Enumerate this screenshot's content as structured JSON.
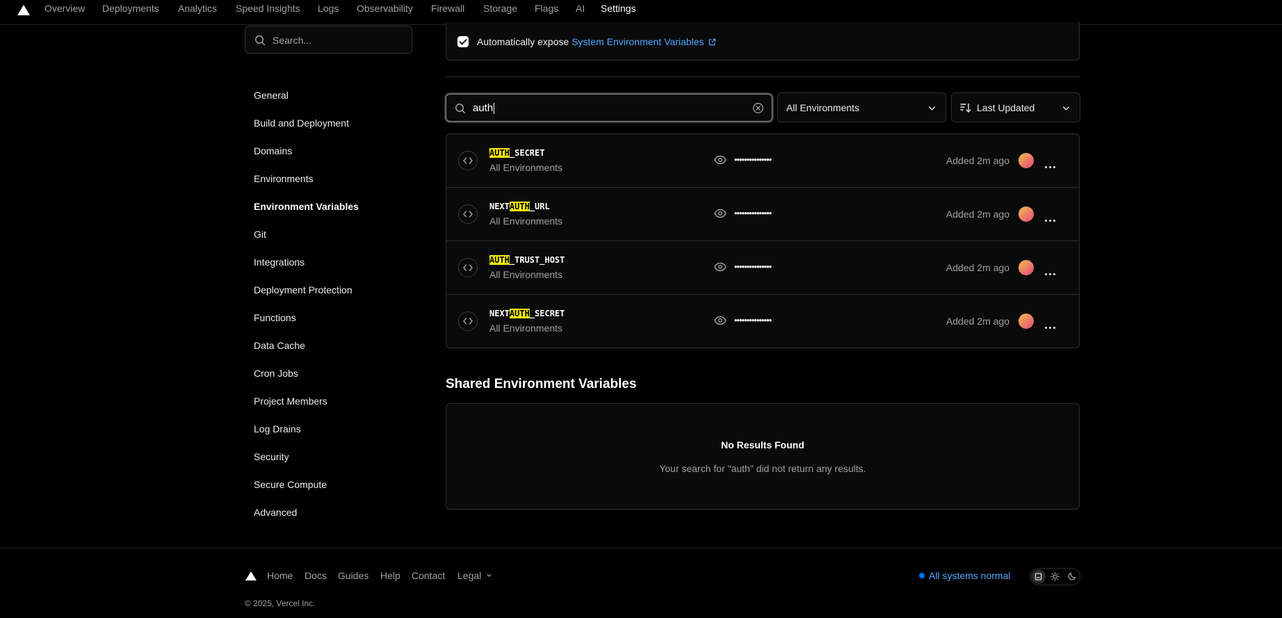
{
  "nav": {
    "tabs": [
      {
        "label": "Overview"
      },
      {
        "label": "Deployments"
      },
      {
        "label": "Analytics"
      },
      {
        "label": "Speed Insights"
      },
      {
        "label": "Logs"
      },
      {
        "label": "Observability"
      },
      {
        "label": "Firewall"
      },
      {
        "label": "Storage"
      },
      {
        "label": "Flags"
      },
      {
        "label": "AI"
      },
      {
        "label": "Settings"
      }
    ],
    "active_tab": "Settings"
  },
  "sidebar": {
    "search_placeholder": "Search...",
    "items": [
      {
        "label": "General"
      },
      {
        "label": "Build and Deployment"
      },
      {
        "label": "Domains"
      },
      {
        "label": "Environments"
      },
      {
        "label": "Environment Variables"
      },
      {
        "label": "Git"
      },
      {
        "label": "Integrations"
      },
      {
        "label": "Deployment Protection"
      },
      {
        "label": "Functions"
      },
      {
        "label": "Data Cache"
      },
      {
        "label": "Cron Jobs"
      },
      {
        "label": "Project Members"
      },
      {
        "label": "Log Drains"
      },
      {
        "label": "Security"
      },
      {
        "label": "Secure Compute"
      },
      {
        "label": "Advanced"
      }
    ],
    "active_item": "Environment Variables"
  },
  "expose": {
    "checked": true,
    "text": "Automatically expose",
    "link": "System Environment Variables"
  },
  "filters": {
    "search_value": "auth",
    "environment": "All Environments",
    "sort": "Last Updated"
  },
  "variables": [
    {
      "name_before": "",
      "name_match": "AUTH",
      "name_after": "_SECRET",
      "environment": "All Environments",
      "masked_value": "•••••••••••••••",
      "added": "Added 2m ago"
    },
    {
      "name_before": "NEXT",
      "name_match": "AUTH",
      "name_after": "_URL",
      "environment": "All Environments",
      "masked_value": "•••••••••••••••",
      "added": "Added 2m ago"
    },
    {
      "name_before": "",
      "name_match": "AUTH",
      "name_after": "_TRUST_HOST",
      "environment": "All Environments",
      "masked_value": "•••••••••••••••",
      "added": "Added 2m ago"
    },
    {
      "name_before": "NEXT",
      "name_match": "AUTH",
      "name_after": "_SECRET",
      "environment": "All Environments",
      "masked_value": "•••••••••••••••",
      "added": "Added 2m ago"
    }
  ],
  "shared": {
    "title": "Shared Environment Variables",
    "empty_title": "No Results Found",
    "empty_description": "Your search for \"auth\" did not return any results."
  },
  "footer": {
    "links": [
      {
        "label": "Home"
      },
      {
        "label": "Docs"
      },
      {
        "label": "Guides"
      },
      {
        "label": "Help"
      },
      {
        "label": "Contact"
      },
      {
        "label": "Legal"
      }
    ],
    "status": "All systems normal",
    "copyright": "© 2025, Vercel Inc."
  },
  "colors": {
    "background": "#000000",
    "link": "#52a8ff",
    "highlight": "#f5e90b",
    "status_dot": "#0070f3"
  }
}
